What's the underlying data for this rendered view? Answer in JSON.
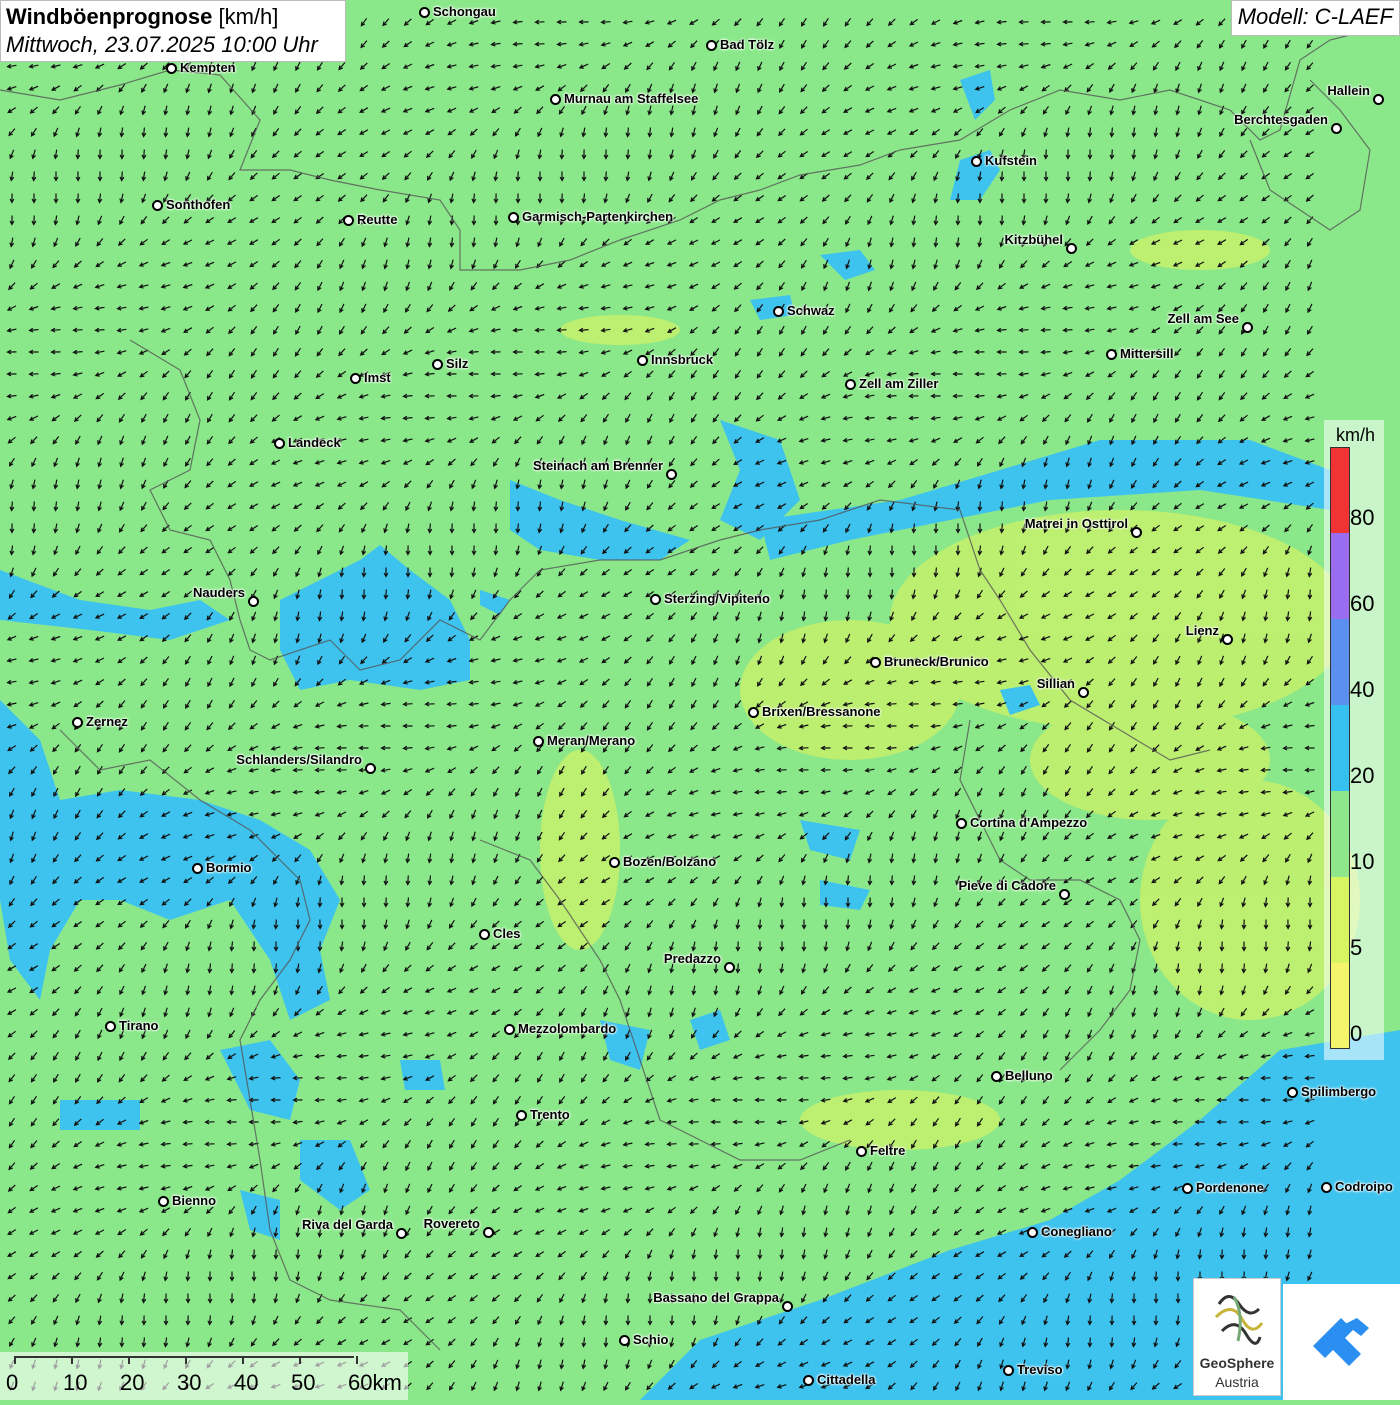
{
  "header": {
    "title": "Windböenprognose",
    "unit": "[km/h]",
    "datetime": "Mittwoch, 23.07.2025 10:00 Uhr",
    "model": "Modell: C-LAEF"
  },
  "legend": {
    "unit": "km/h",
    "steps": [
      {
        "label": "0",
        "color": "#f4f56a"
      },
      {
        "label": "5",
        "color": "#d6f561"
      },
      {
        "label": "10",
        "color": "#8ee88b"
      },
      {
        "label": "20",
        "color": "#35c0f0"
      },
      {
        "label": "40",
        "color": "#5b8ff0"
      },
      {
        "label": "60",
        "color": "#9a6df0"
      },
      {
        "label": "80",
        "color": "#f03434"
      }
    ]
  },
  "scale": {
    "labels": [
      "0",
      "10",
      "20",
      "30",
      "40",
      "50",
      "60km"
    ]
  },
  "cities": [
    {
      "name": "Schongau"
    },
    {
      "name": "Bad Tölz"
    },
    {
      "name": "Kempten"
    },
    {
      "name": "Hallein"
    },
    {
      "name": "Murnau am Staffelsee"
    },
    {
      "name": "Berchtesgaden"
    },
    {
      "name": "Kufstein"
    },
    {
      "name": "Sonthofen"
    },
    {
      "name": "Reutte"
    },
    {
      "name": "Garmisch-Partenkirchen"
    },
    {
      "name": "Kitzbühel"
    },
    {
      "name": "Schwaz"
    },
    {
      "name": "Zell am See"
    },
    {
      "name": "Mittersill"
    },
    {
      "name": "Innsbruck"
    },
    {
      "name": "Silz"
    },
    {
      "name": "Imst"
    },
    {
      "name": "Zell am Ziller"
    },
    {
      "name": "Landeck"
    },
    {
      "name": "Steinach am Brenner"
    },
    {
      "name": "Matrei in Osttirol"
    },
    {
      "name": "Nauders"
    },
    {
      "name": "Sterzing/Vipiteno"
    },
    {
      "name": "Lienz"
    },
    {
      "name": "Bruneck/Brunico"
    },
    {
      "name": "Sillian"
    },
    {
      "name": "Brixen/Bressanone"
    },
    {
      "name": "Zernez"
    },
    {
      "name": "Meran/Merano"
    },
    {
      "name": "Schlanders/Silandro"
    },
    {
      "name": "Cortina d'Ampezzo"
    },
    {
      "name": "Bozen/Bolzano"
    },
    {
      "name": "Bormio"
    },
    {
      "name": "Pieve di Cadore"
    },
    {
      "name": "Cles"
    },
    {
      "name": "Predazzo"
    },
    {
      "name": "Tirano"
    },
    {
      "name": "Mezzolombardo"
    },
    {
      "name": "Belluno"
    },
    {
      "name": "Spilimbergo"
    },
    {
      "name": "Trento"
    },
    {
      "name": "Feltre"
    },
    {
      "name": "Pordenone"
    },
    {
      "name": "Codroipo"
    },
    {
      "name": "Bienno"
    },
    {
      "name": "Riva del Garda"
    },
    {
      "name": "Rovereto"
    },
    {
      "name": "Conegliano"
    },
    {
      "name": "Bassano del Grappa"
    },
    {
      "name": "Schio"
    },
    {
      "name": "Treviso"
    },
    {
      "name": "Cittadella"
    }
  ],
  "logos": {
    "geosphere_name": "GeoSphere",
    "geosphere_sub": "Austria"
  }
}
